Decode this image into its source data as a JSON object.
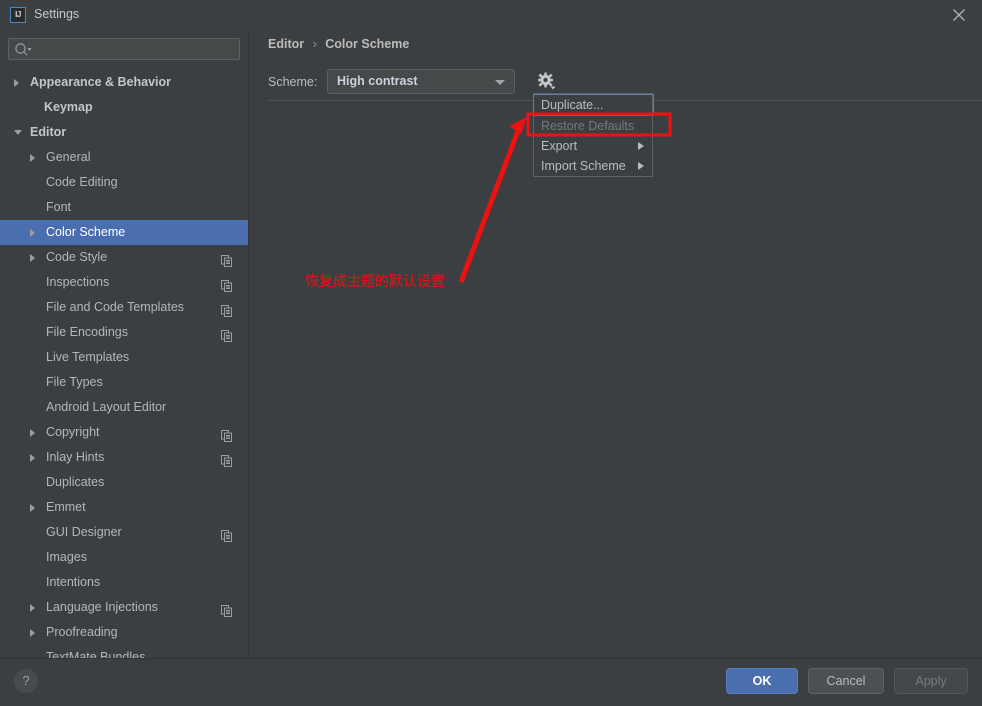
{
  "window": {
    "title": "Settings",
    "logo_text": "IJ",
    "close_icon": "close-icon"
  },
  "search": {
    "value": "",
    "placeholder": "",
    "icon": "search-icon"
  },
  "sidebar": {
    "items": [
      {
        "label": "Appearance & Behavior",
        "indent": 30,
        "arrow": "collapsed",
        "bold": true,
        "selected": false,
        "copy": false
      },
      {
        "label": "Keymap",
        "indent": 44,
        "arrow": "none",
        "bold": true,
        "selected": false,
        "copy": false
      },
      {
        "label": "Editor",
        "indent": 30,
        "arrow": "expanded",
        "bold": true,
        "selected": false,
        "copy": false
      },
      {
        "label": "General",
        "indent": 46,
        "arrow": "collapsed",
        "bold": false,
        "selected": false,
        "copy": false
      },
      {
        "label": "Code Editing",
        "indent": 46,
        "arrow": "none",
        "bold": false,
        "selected": false,
        "copy": false
      },
      {
        "label": "Font",
        "indent": 46,
        "arrow": "none",
        "bold": false,
        "selected": false,
        "copy": false
      },
      {
        "label": "Color Scheme",
        "indent": 46,
        "arrow": "collapsed",
        "bold": false,
        "selected": true,
        "copy": false
      },
      {
        "label": "Code Style",
        "indent": 46,
        "arrow": "collapsed",
        "bold": false,
        "selected": false,
        "copy": true
      },
      {
        "label": "Inspections",
        "indent": 46,
        "arrow": "none",
        "bold": false,
        "selected": false,
        "copy": true
      },
      {
        "label": "File and Code Templates",
        "indent": 46,
        "arrow": "none",
        "bold": false,
        "selected": false,
        "copy": true
      },
      {
        "label": "File Encodings",
        "indent": 46,
        "arrow": "none",
        "bold": false,
        "selected": false,
        "copy": true
      },
      {
        "label": "Live Templates",
        "indent": 46,
        "arrow": "none",
        "bold": false,
        "selected": false,
        "copy": false
      },
      {
        "label": "File Types",
        "indent": 46,
        "arrow": "none",
        "bold": false,
        "selected": false,
        "copy": false
      },
      {
        "label": "Android Layout Editor",
        "indent": 46,
        "arrow": "none",
        "bold": false,
        "selected": false,
        "copy": false
      },
      {
        "label": "Copyright",
        "indent": 46,
        "arrow": "collapsed",
        "bold": false,
        "selected": false,
        "copy": true
      },
      {
        "label": "Inlay Hints",
        "indent": 46,
        "arrow": "collapsed",
        "bold": false,
        "selected": false,
        "copy": true
      },
      {
        "label": "Duplicates",
        "indent": 46,
        "arrow": "none",
        "bold": false,
        "selected": false,
        "copy": false
      },
      {
        "label": "Emmet",
        "indent": 46,
        "arrow": "collapsed",
        "bold": false,
        "selected": false,
        "copy": false
      },
      {
        "label": "GUI Designer",
        "indent": 46,
        "arrow": "none",
        "bold": false,
        "selected": false,
        "copy": true
      },
      {
        "label": "Images",
        "indent": 46,
        "arrow": "none",
        "bold": false,
        "selected": false,
        "copy": false
      },
      {
        "label": "Intentions",
        "indent": 46,
        "arrow": "none",
        "bold": false,
        "selected": false,
        "copy": false
      },
      {
        "label": "Language Injections",
        "indent": 46,
        "arrow": "collapsed",
        "bold": false,
        "selected": false,
        "copy": true
      },
      {
        "label": "Proofreading",
        "indent": 46,
        "arrow": "collapsed",
        "bold": false,
        "selected": false,
        "copy": false
      },
      {
        "label": "TextMate Bundles",
        "indent": 46,
        "arrow": "none",
        "bold": false,
        "selected": false,
        "copy": false
      }
    ]
  },
  "content": {
    "breadcrumb": {
      "parent": "Editor",
      "separator": "›",
      "current": "Color Scheme"
    },
    "scheme": {
      "label": "Scheme:",
      "selected": "High contrast",
      "gear_icon": "gear-icon"
    }
  },
  "menu": {
    "items": [
      {
        "label": "Duplicate...",
        "state": "focused",
        "submenu": false
      },
      {
        "label": "Restore Defaults",
        "state": "disabled",
        "submenu": false
      },
      {
        "label": "Export",
        "state": "normal",
        "submenu": true
      },
      {
        "label": "Import Scheme",
        "state": "normal",
        "submenu": true
      }
    ]
  },
  "annotation": {
    "text": "恢复成主题的默认设置",
    "color": "#ee1111"
  },
  "footer": {
    "help_label": "?",
    "ok_label": "OK",
    "cancel_label": "Cancel",
    "apply_label": "Apply"
  },
  "colors": {
    "background": "#3c3f41",
    "selection": "#4b6eaf",
    "accent": "#5b7fb9",
    "annotation": "#ee1111"
  }
}
